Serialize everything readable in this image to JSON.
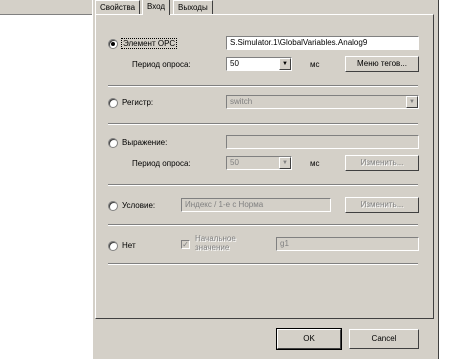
{
  "tabs": [
    {
      "label": "Свойства"
    },
    {
      "label": "Вход"
    },
    {
      "label": "Выходы"
    }
  ],
  "opc": {
    "radio_label": "Элемент OPC",
    "value": "S.Simulator.1\\GlobalVariables.Analog9",
    "period_label": "Период опроса:",
    "period_value": "50",
    "unit": "мс",
    "tags_button": "Меню тегов..."
  },
  "register": {
    "radio_label": "Регистр:",
    "value": "switch"
  },
  "expression": {
    "radio_label": "Выражение:",
    "value": "",
    "period_label": "Период опроса:",
    "period_value": "50",
    "unit": "мс",
    "edit_button": "Изменить..."
  },
  "condition": {
    "radio_label": "Условие:",
    "value": "Индекс / 1-е с Норма",
    "edit_button": "Изменить..."
  },
  "none": {
    "radio_label": "Нет",
    "initial_label_line1": "Начальное",
    "initial_label_line2": "значение",
    "initial_value": "g1"
  },
  "footer": {
    "ok": "OK",
    "cancel": "Cancel"
  },
  "icons": {
    "combo_arrow": "▼",
    "check_mark": "✓"
  }
}
